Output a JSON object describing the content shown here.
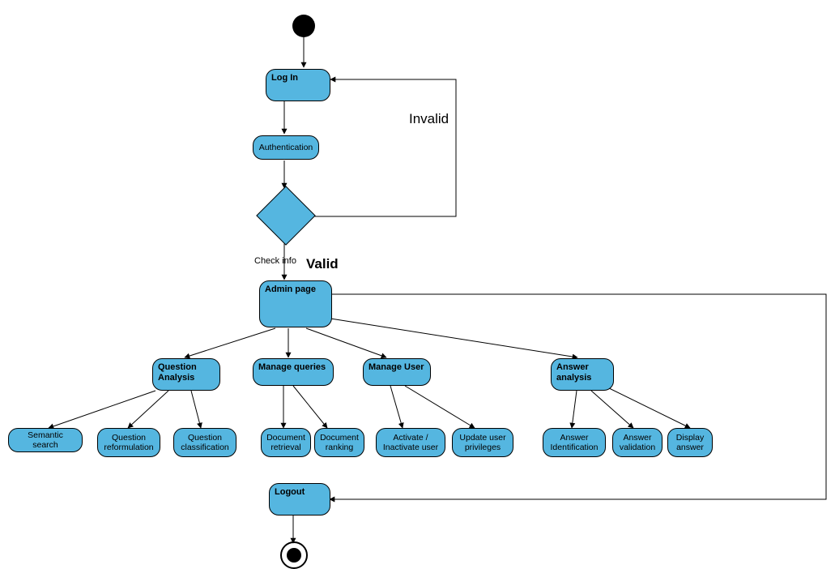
{
  "nodes": {
    "login": "Log In",
    "auth": "Authentication",
    "admin": "Admin page",
    "qa": "Question Analysis",
    "mq": "Manage queries",
    "mu": "Manage User",
    "aa": "Answer analysis",
    "semSearch": "Semantic search",
    "qReform": "Question reformulation",
    "qClass": "Question classification",
    "docRetr": "Document retrieval",
    "docRank": "Document ranking",
    "actUser": "Activate / Inactivate user",
    "updPriv": "Update user privileges",
    "ansId": "Answer Identification",
    "ansVal": "Answer validation",
    "dispAns": "Display answer",
    "logout": "Logout"
  },
  "labels": {
    "invalid": "Invalid",
    "checkInfo": "Check info",
    "valid": "Valid"
  }
}
